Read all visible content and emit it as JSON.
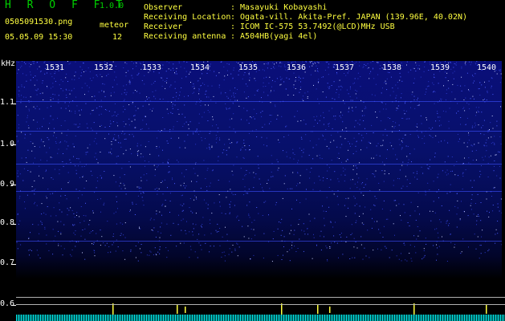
{
  "header": {
    "app_name": "H R O F F T",
    "app_version": "1.0.0",
    "file_name": "0505091530.png",
    "meteor_label": "meteor",
    "date_time": "05.05.09 15:30",
    "meteor_count": "12"
  },
  "metadata": [
    {
      "key": "Observer",
      "value": ": Masayuki Kobayashi"
    },
    {
      "key": "Receiving Location",
      "value": ": Ogata-vill. Akita-Pref. JAPAN (139.96E, 40.02N)"
    },
    {
      "key": "Receiver",
      "value": ": ICOM IC-575 53.7492(@LCD)MHz USB"
    },
    {
      "key": "Receiving antenna",
      "value": ": A504HB(yagi 4el)"
    }
  ],
  "spectrogram": {
    "y_unit": "kHz",
    "y_ticks": [
      "1.1",
      "1.0",
      "0.9",
      "0.8",
      "0.7",
      "0.6"
    ],
    "x_ticks": [
      "1531",
      "1532",
      "1533",
      "1534",
      "1535",
      "1536",
      "1537",
      "1538",
      "1539",
      "1540"
    ],
    "colors": {
      "signal": "#ffff40",
      "background": "#0a0f7a",
      "noise": "#00e0e0"
    }
  }
}
